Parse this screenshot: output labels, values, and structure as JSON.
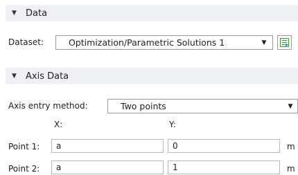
{
  "data_section": {
    "title": "Data",
    "dataset_label": "Dataset:",
    "dataset_value": "Optimization/Parametric Solutions 1",
    "dataset_options": [
      "Optimization/Parametric Solutions 1"
    ],
    "icon": "go-to-source-icon"
  },
  "axis_section": {
    "title": "Axis Data",
    "entry_method_label": "Axis entry method:",
    "entry_method_value": "Two points",
    "x_header": "X:",
    "y_header": "Y:",
    "points": [
      {
        "label": "Point 1:",
        "x": "a",
        "y": "0",
        "unit": "m"
      },
      {
        "label": "Point 2:",
        "x": "a",
        "y": "1",
        "unit": "m"
      }
    ]
  }
}
